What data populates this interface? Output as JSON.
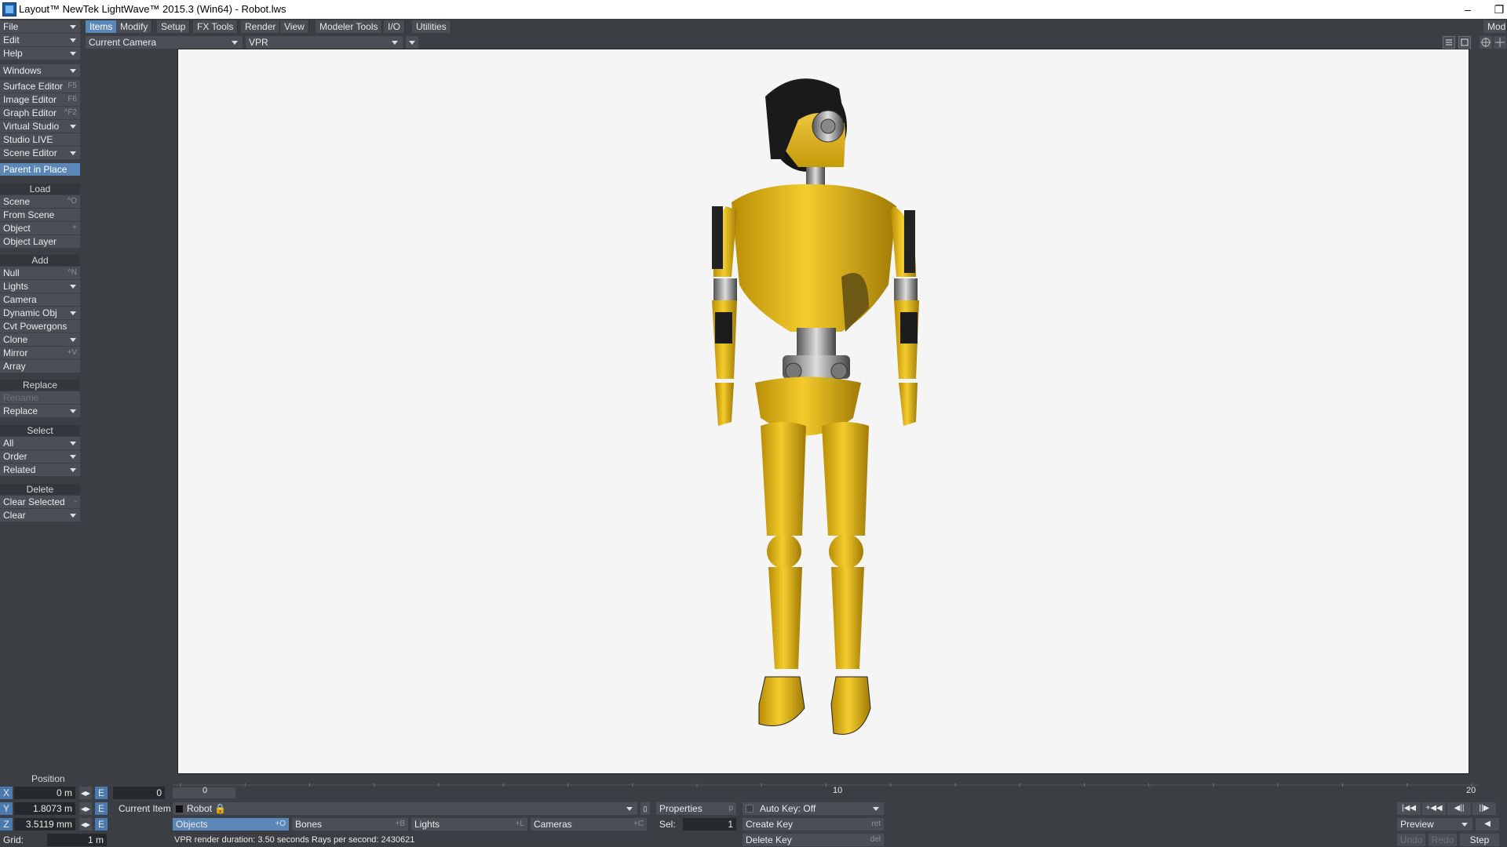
{
  "window": {
    "title": "Layout™ NewTek LightWave™ 2015.3 (Win64) - Robot.lws",
    "minimize": "–",
    "maximize": "❐"
  },
  "menubar": {
    "tabs": [
      "Items",
      "Modify",
      "Setup",
      "FX Tools",
      "Render",
      "View",
      "Modeler Tools",
      "I/O",
      "Utilities"
    ],
    "right_label": "Mod"
  },
  "left_panel": {
    "top": [
      "File",
      "Edit",
      "Help"
    ],
    "windows": "Windows",
    "editors": [
      {
        "label": "Surface Editor",
        "shortcut": "F5"
      },
      {
        "label": "Image Editor",
        "shortcut": "F6"
      },
      {
        "label": "Graph Editor",
        "shortcut": "^F2"
      },
      {
        "label": "Virtual Studio",
        "shortcut": ""
      },
      {
        "label": "Studio LIVE",
        "shortcut": ""
      },
      {
        "label": "Scene Editor",
        "shortcut": ""
      }
    ],
    "parent_in_place": "Parent in Place",
    "load_header": "Load",
    "load_items": [
      {
        "label": "Scene",
        "shortcut": "^O"
      },
      {
        "label": "From Scene",
        "shortcut": ""
      },
      {
        "label": "Object",
        "shortcut": "+"
      },
      {
        "label": "Object Layer",
        "shortcut": ""
      }
    ],
    "add_header": "Add",
    "add_items": [
      {
        "label": "Null",
        "shortcut": "^N"
      },
      {
        "label": "Lights",
        "shortcut": ""
      },
      {
        "label": "Camera",
        "shortcut": ""
      },
      {
        "label": "Dynamic Obj",
        "shortcut": ""
      },
      {
        "label": "Cvt Powergons",
        "shortcut": ""
      },
      {
        "label": "Clone",
        "shortcut": ""
      },
      {
        "label": "Mirror",
        "shortcut": "+V"
      },
      {
        "label": "Array",
        "shortcut": ""
      }
    ],
    "replace_header": "Replace",
    "replace_items": [
      "Rename",
      "Replace"
    ],
    "select_header": "Select",
    "select_items": [
      "All",
      "Order",
      "Related"
    ],
    "delete_header": "Delete",
    "delete_items": [
      {
        "label": "Clear Selected",
        "shortcut": "-"
      },
      {
        "label": "Clear",
        "shortcut": ""
      }
    ]
  },
  "viewport_bar": {
    "camera": "Current Camera",
    "mode": "VPR"
  },
  "timeline": {
    "start": "0",
    "mid": "10",
    "end": "20",
    "current": "0",
    "ticks": 20
  },
  "bottom": {
    "position_header": "Position",
    "x_label": "X",
    "x_value": "0 m",
    "y_label": "Y",
    "y_value": "1.8073 m",
    "z_label": "Z",
    "z_value": "3.5119 mm",
    "e_label": "E",
    "grid_label": "Grid:",
    "grid_value": "1 m",
    "frame_value": "0",
    "current_item_label": "Current Item",
    "current_item": "Robot",
    "objects": "Objects",
    "objects_sc": "+O",
    "bones": "Bones",
    "bones_sc": "+B",
    "lights": "Lights",
    "lights_sc": "+L",
    "cameras": "Cameras",
    "cameras_sc": "+C",
    "properties": "Properties",
    "properties_sc": "p",
    "sel_label": "Sel:",
    "sel_value": "1",
    "auto_key": "Auto Key: Off",
    "create_key": "Create Key",
    "create_key_sc": "ret",
    "delete_key": "Delete Key",
    "delete_key_sc": "del",
    "status": "VPR render duration: 3.50 seconds  Rays per second: 2430621",
    "preview": "Preview",
    "undo": "Undo",
    "redo": "Redo",
    "step": "Step"
  },
  "colors": {
    "accent": "#5b87b8",
    "panel": "#3b3f44",
    "button": "#4b4f55",
    "robot_yellow": "#f0c419"
  }
}
